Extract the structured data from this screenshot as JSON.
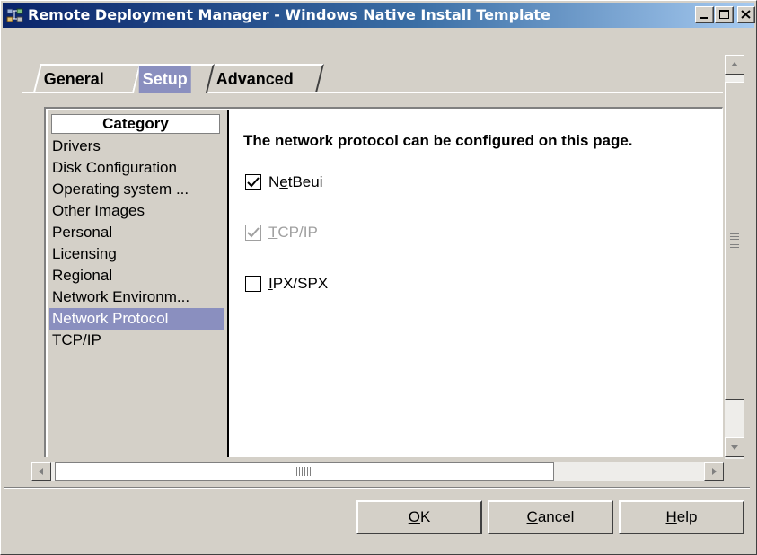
{
  "window": {
    "title": "Remote Deployment Manager - Windows Native Install Template"
  },
  "tabs": [
    {
      "label": "General",
      "selected": false
    },
    {
      "label": "Setup",
      "selected": true
    },
    {
      "label": "Advanced",
      "selected": false
    }
  ],
  "category": {
    "header": "Category",
    "items": [
      {
        "label": "Drivers"
      },
      {
        "label": "Disk Configuration"
      },
      {
        "label": "Operating system ..."
      },
      {
        "label": "Other Images"
      },
      {
        "label": "Personal"
      },
      {
        "label": "Licensing"
      },
      {
        "label": "Regional"
      },
      {
        "label": "Network Environm..."
      },
      {
        "label": "Network Protocol",
        "selected": true
      },
      {
        "label": "TCP/IP"
      }
    ]
  },
  "protocol_page": {
    "heading": "The network protocol can be configured on this page.",
    "options": [
      {
        "label_before": "N",
        "mnemonic": "e",
        "label_after": "tBeui",
        "checked": true,
        "enabled": true
      },
      {
        "label_before": "",
        "mnemonic": "T",
        "label_after": "CP/IP",
        "checked": true,
        "enabled": false
      },
      {
        "label_before": "",
        "mnemonic": "I",
        "label_after": "PX/SPX",
        "checked": false,
        "enabled": true
      }
    ]
  },
  "buttons": {
    "ok": {
      "mnemonic": "O",
      "rest": "K"
    },
    "cancel": {
      "mnemonic": "C",
      "rest": "ancel"
    },
    "help": {
      "mnemonic": "H",
      "rest": "elp"
    }
  },
  "colors": {
    "selection": "#8a8fbf",
    "titlebar_start": "#0a246a",
    "titlebar_end": "#a6caf0",
    "face": "#d4d0c8"
  },
  "icons": {
    "app": "network-deploy-icon",
    "minimize": "minimize-icon",
    "maximize": "maximize-icon",
    "close": "close-icon"
  }
}
